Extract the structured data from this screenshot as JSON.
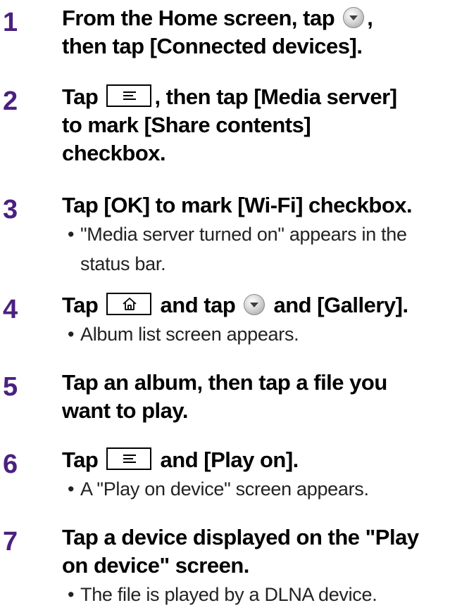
{
  "steps": [
    {
      "number": "1",
      "instruction_parts": [
        "From the Home screen, tap ",
        ",",
        "then tap [Connected devices]."
      ]
    },
    {
      "number": "2",
      "instruction_parts": [
        "Tap ",
        ", then tap [Media server]",
        "to mark [Share contents]",
        "checkbox."
      ]
    },
    {
      "number": "3",
      "instruction_parts": [
        "Tap [OK] to mark [Wi-Fi] checkbox."
      ],
      "note_lines": [
        "\"Media server turned on\" appears in the",
        "status bar."
      ]
    },
    {
      "number": "4",
      "instruction_parts": [
        "Tap ",
        " and tap ",
        " and [Gallery]."
      ],
      "note_lines": [
        "Album list screen appears."
      ]
    },
    {
      "number": "5",
      "instruction_parts": [
        "Tap an album, then tap a file you",
        "want to play."
      ]
    },
    {
      "number": "6",
      "instruction_parts": [
        "Tap ",
        " and [Play on]."
      ],
      "note_lines": [
        "A \"Play on device\" screen appears."
      ]
    },
    {
      "number": "7",
      "instruction_parts": [
        "Tap a device displayed on the \"Play",
        "on device\" screen."
      ],
      "note_lines": [
        "The file is played by a DLNA device."
      ]
    }
  ],
  "bullet": "•",
  "colors": {
    "step_number": "#4a2080",
    "text": "#000000",
    "note_text": "#222222"
  },
  "icons": {
    "apps_ball": "apps-ball-icon",
    "menu_key": "menu-key-icon",
    "home_key": "home-key-icon"
  }
}
